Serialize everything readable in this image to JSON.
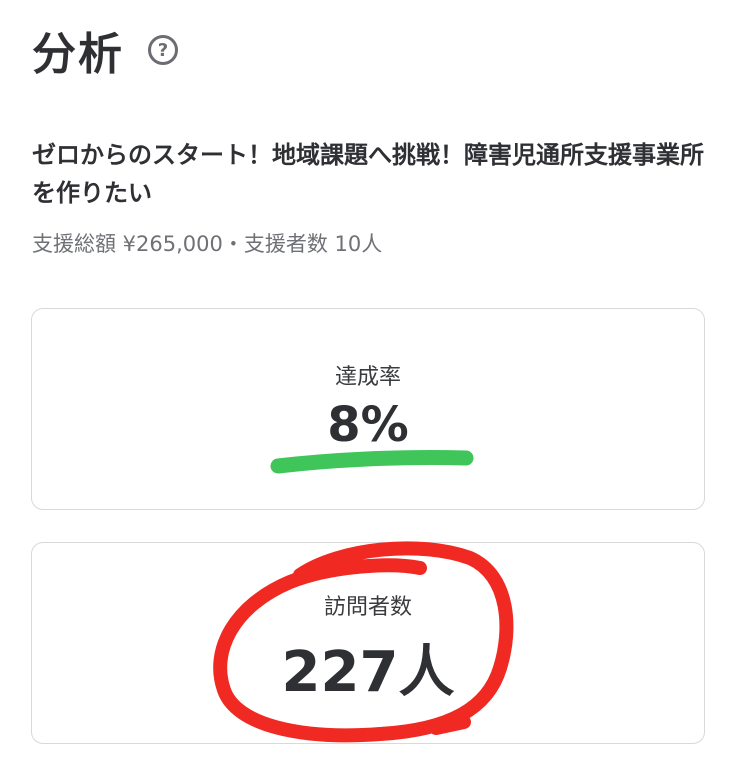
{
  "header": {
    "title": "分析",
    "help_icon": "question-circle-icon"
  },
  "project": {
    "title": "ゼロからのスタート！地域課題へ挑戦！障害児通所支援事業所を作りたい",
    "meta": "支援総額 ¥265,000・支援者数 10人"
  },
  "stats": {
    "achievement": {
      "label": "達成率",
      "value": "8%"
    },
    "visitors": {
      "label": "訪問者数",
      "value": "227人"
    }
  },
  "annotations": {
    "underline_color": "#3fc55a",
    "circle_color": "#f02a22"
  }
}
